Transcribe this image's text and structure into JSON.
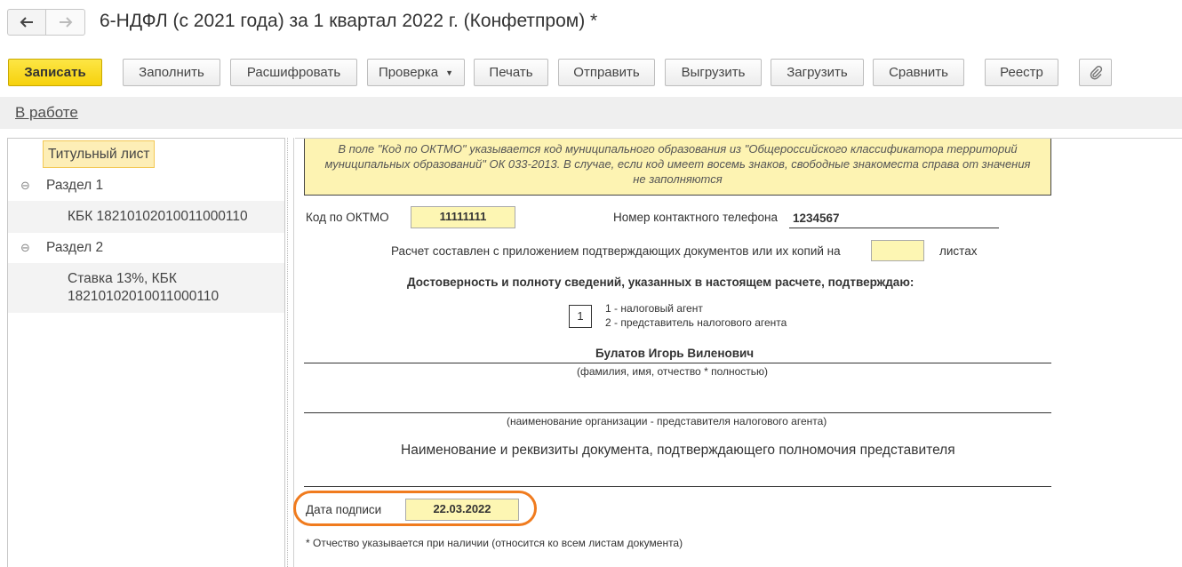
{
  "window": {
    "title": "6-НДФЛ (с 2021 года) за 1 квартал 2022 г. (Конфетпром) *",
    "back_icon": "arrow-left-icon",
    "forward_icon": "arrow-right-icon"
  },
  "toolbar": {
    "save_label": "Записать",
    "fill_label": "Заполнить",
    "decode_label": "Расшифровать",
    "check_label": "Проверка",
    "print_label": "Печать",
    "send_label": "Отправить",
    "export_label": "Выгрузить",
    "import_label": "Загрузить",
    "compare_label": "Сравнить",
    "registry_label": "Реестр",
    "attach_icon": "paperclip-icon"
  },
  "status": {
    "label": "В работе"
  },
  "tree": {
    "items": [
      {
        "label": "Титульный лист",
        "selected": true
      },
      {
        "label": "Раздел 1",
        "toggle": "⊖"
      },
      {
        "label": "КБК 18210102010011000110"
      },
      {
        "label": "Раздел 2",
        "toggle": "⊖"
      },
      {
        "label_line1": "Ставка 13%, КБК",
        "label_line2": "18210102010011000110"
      }
    ]
  },
  "form": {
    "hint": "В поле \"Код по ОКТМО\" указывается код муниципального образования из \"Общероссийского классификатора территорий муниципальных образований\" ОК 033-2013. В случае, если код имеет восемь знаков, свободные знакоместа справа от значения не заполняются",
    "oktmo_label": "Код по ОКТМО",
    "oktmo_value": "11111111",
    "phone_label": "Номер контактного телефона",
    "phone_value": "1234567",
    "attachments_label": "Расчет составлен с приложением подтверждающих документов или их копий на",
    "attachments_value": "",
    "sheets_label": "листах",
    "confirm_heading": "Достоверность и полноту сведений, указанных в настоящем расчете, подтверждаю:",
    "signer_code": "1",
    "signer_option1": "1 - налоговый агент",
    "signer_option2": "2 - представитель налогового агента",
    "signer_name": "Булатов Игорь Виленович",
    "signer_name_caption": "(фамилия, имя, отчество * полностью)",
    "org_caption": "(наименование организации - представителя налогового агента)",
    "doc_heading": "Наименование и реквизиты документа, подтверждающего полномочия представителя",
    "sign_date_label": "Дата подписи",
    "sign_date_value": "22.03.2022",
    "footnote": "* Отчество указывается при наличии (относится ко всем листам документа)"
  },
  "colors": {
    "primary_button": "#f6d10c",
    "field_bg": "#fdf6b3",
    "highlight": "#f07b1e"
  }
}
